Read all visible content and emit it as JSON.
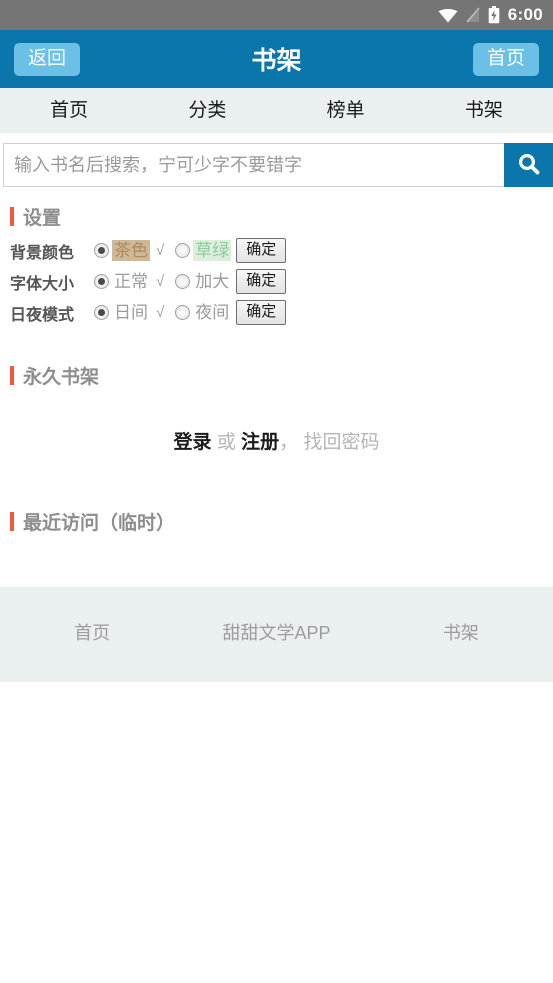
{
  "statusbar": {
    "time": "6:00",
    "icons": [
      "wifi-icon",
      "no-signal-icon",
      "battery-charging-icon"
    ]
  },
  "appbar": {
    "back_label": "返回",
    "title": "书架",
    "home_label": "首页",
    "bg_color": "#0b76ab",
    "button_color": "#6cc0e6"
  },
  "tabs": [
    {
      "label": "首页"
    },
    {
      "label": "分类"
    },
    {
      "label": "榜单"
    },
    {
      "label": "书架"
    }
  ],
  "search": {
    "placeholder": "输入书名后搜索，宁可少字不要错字",
    "value": "",
    "button_icon": "search-icon"
  },
  "sections": {
    "settings": {
      "title": "设置",
      "marker_color": "#f4593c",
      "rows": [
        {
          "label": "背景颜色",
          "option_a": "茶色",
          "option_a_selected": true,
          "option_a_swatch": "#cdb897",
          "check": "√",
          "option_b": "草绿",
          "option_b_selected": false,
          "option_b_swatch": "#ddeedd",
          "confirm": "确定"
        },
        {
          "label": "字体大小",
          "option_a": "正常",
          "option_a_selected": true,
          "check": "√",
          "option_b": "加大",
          "option_b_selected": false,
          "confirm": "确定"
        },
        {
          "label": "日夜模式",
          "option_a": "日间",
          "option_a_selected": true,
          "check": "√",
          "option_b": "夜间",
          "option_b_selected": false,
          "confirm": "确定"
        }
      ]
    },
    "permanent_shelf": {
      "title": "永久书架",
      "login_label": "登录",
      "or_label": "或",
      "register_label": "注册",
      "comma": "，",
      "forgot_label": "找回密码"
    },
    "recent": {
      "title": "最近访问（临时）"
    }
  },
  "footer": {
    "links": [
      {
        "label": "首页"
      },
      {
        "label": "甜甜文学APP"
      },
      {
        "label": "书架"
      }
    ]
  }
}
